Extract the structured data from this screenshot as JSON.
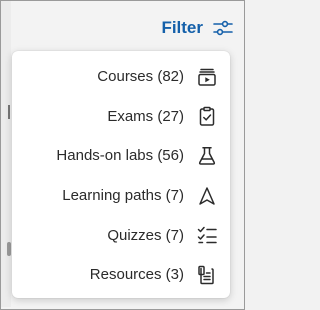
{
  "header": {
    "filter_label": "Filter",
    "filter_icon": "sliders-icon"
  },
  "menu": {
    "items": [
      {
        "label": "Courses (82)",
        "icon": "course-play-icon"
      },
      {
        "label": "Exams (27)",
        "icon": "clipboard-check-icon"
      },
      {
        "label": "Hands-on labs (56)",
        "icon": "flask-icon"
      },
      {
        "label": "Learning paths (7)",
        "icon": "navigation-arrow-icon"
      },
      {
        "label": "Quizzes (7)",
        "icon": "checklist-icon"
      },
      {
        "label": "Resources (3)",
        "icon": "document-icon"
      }
    ]
  },
  "colors": {
    "accent": "#1460aa",
    "text": "#2b2b2b",
    "menu_bg": "#ffffff"
  }
}
